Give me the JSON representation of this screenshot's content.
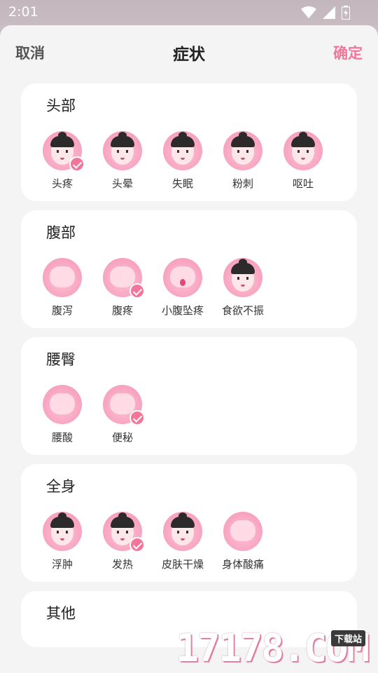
{
  "status": {
    "time": "2:01"
  },
  "header": {
    "cancel": "取消",
    "title": "症状",
    "confirm": "确定"
  },
  "sections": [
    {
      "title": "头部",
      "items": [
        {
          "label": "头疼",
          "icon": "face-headache-icon",
          "selected": true
        },
        {
          "label": "头晕",
          "icon": "face-dizzy-icon",
          "selected": false
        },
        {
          "label": "失眠",
          "icon": "face-insomnia-icon",
          "selected": false
        },
        {
          "label": "粉刺",
          "icon": "face-acne-icon",
          "selected": false
        },
        {
          "label": "呕吐",
          "icon": "face-vomit-icon",
          "selected": false
        }
      ]
    },
    {
      "title": "腹部",
      "items": [
        {
          "label": "腹泻",
          "icon": "stomach-icon",
          "selected": false
        },
        {
          "label": "腹疼",
          "icon": "abdomen-pain-icon",
          "selected": true
        },
        {
          "label": "小腹坠疼",
          "icon": "lower-abdomen-icon",
          "selected": false
        },
        {
          "label": "食欲不振",
          "icon": "face-no-appetite-icon",
          "selected": false
        }
      ]
    },
    {
      "title": "腰臀",
      "items": [
        {
          "label": "腰酸",
          "icon": "waist-icon",
          "selected": false
        },
        {
          "label": "便秘",
          "icon": "toilet-paper-icon",
          "selected": true
        }
      ]
    },
    {
      "title": "全身",
      "items": [
        {
          "label": "浮肿",
          "icon": "face-swelling-icon",
          "selected": false
        },
        {
          "label": "发热",
          "icon": "face-fever-icon",
          "selected": true
        },
        {
          "label": "皮肤干燥",
          "icon": "face-dry-skin-icon",
          "selected": false
        },
        {
          "label": "身体酸痛",
          "icon": "body-ache-icon",
          "selected": false
        }
      ]
    },
    {
      "title": "其他",
      "items": []
    }
  ],
  "watermark": {
    "text": "17178.COM",
    "tag": "下载站"
  },
  "colors": {
    "accent": "#f2769a",
    "icon_bg": "#f7a2bf"
  }
}
